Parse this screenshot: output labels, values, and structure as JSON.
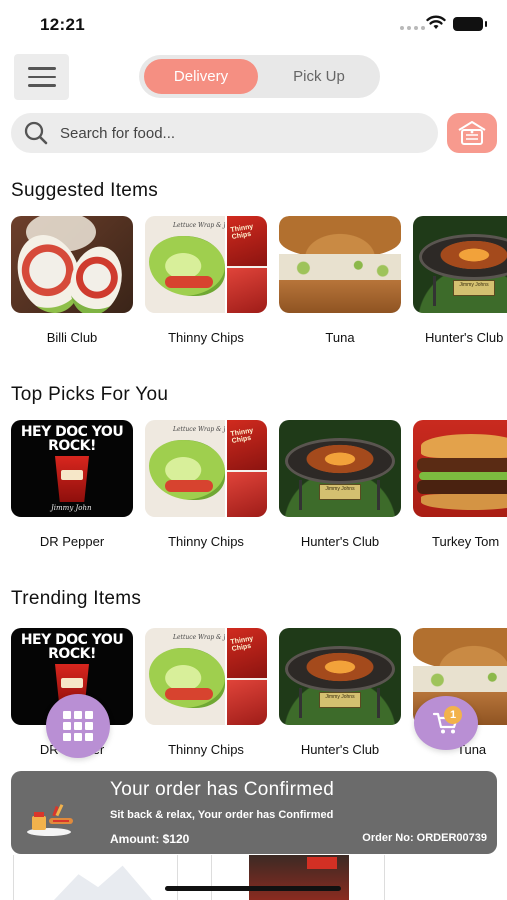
{
  "status_bar": {
    "time": "12:21"
  },
  "toggle": {
    "delivery_label": "Delivery",
    "pickup_label": "Pick Up",
    "active": "Delivery"
  },
  "search": {
    "placeholder": "Search for food..."
  },
  "sections": [
    {
      "title": "Suggested Items",
      "items": [
        {
          "label": "Billi Club",
          "image": "wrap-sandwich"
        },
        {
          "label": "Thinny Chips",
          "image": "lettuce-wrap-chips"
        },
        {
          "label": "Tuna",
          "image": "tuna-sandwich"
        },
        {
          "label": "Hunter's Club",
          "image": "fire-pit-grill"
        }
      ]
    },
    {
      "title": "Top Picks For You",
      "items": [
        {
          "label": "DR Pepper",
          "image": "dr-pepper-cup"
        },
        {
          "label": "Thinny Chips",
          "image": "lettuce-wrap-chips"
        },
        {
          "label": "Hunter's Club",
          "image": "fire-pit-grill"
        },
        {
          "label": "Turkey Tom",
          "image": "stacked-burger"
        }
      ]
    },
    {
      "title": "Trending Items",
      "items": [
        {
          "label": "DR Pepper",
          "image": "dr-pepper-cup"
        },
        {
          "label": "Thinny Chips",
          "image": "lettuce-wrap-chips"
        },
        {
          "label": "Hunter's Club",
          "image": "fire-pit-grill"
        },
        {
          "label": "Tuna",
          "image": "tuna-sandwich"
        }
      ]
    }
  ],
  "image_text": {
    "drpepper_headline": "HEY DOC YOU ROCK!",
    "drpepper_signature": "Jimmy John",
    "lettuce_caption": "Lettuce Wrap & Jimmy John's",
    "chips_text": "Thinny Chips",
    "grill_sign": "Jimmy Johns"
  },
  "cart": {
    "badge_count": "1"
  },
  "order_banner": {
    "title": "Your order has Confirmed",
    "subtitle": "Sit back & relax, Your order has Confirmed",
    "amount": "Amount: $120",
    "order_no": "Order No: ORDER00739"
  },
  "colors": {
    "accent": "#f58f82",
    "fab": "#b98fd4",
    "banner_bg": "#6b6b6b",
    "badge": "#f2b24c"
  },
  "icons": [
    "menu-icon",
    "search-icon",
    "store-icon",
    "grid-icon",
    "cart-icon",
    "wifi-icon",
    "battery-icon",
    "food-order-icon"
  ]
}
